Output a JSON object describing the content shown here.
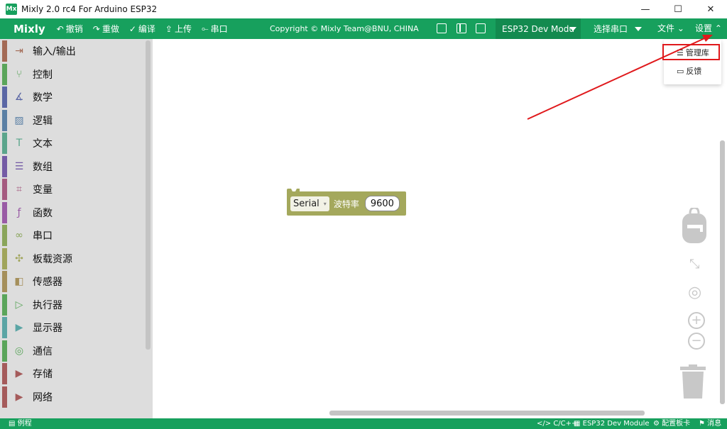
{
  "window": {
    "icon_text": "Mx",
    "title": "Mixly 2.0 rc4 For Arduino ESP32",
    "minimize_glyph": "—",
    "maximize_glyph": "☐",
    "close_glyph": "✕"
  },
  "toolbar": {
    "brand": "Mixly",
    "undo": "撤销",
    "redo": "重做",
    "compile": "编译",
    "upload": "上传",
    "serial": "串口",
    "copyright": "Copyright © Mixly Team@BNU, CHINA",
    "board": "ESP32 Dev Modu",
    "port": "选择串口",
    "file_menu": "文件",
    "settings_menu": "设置",
    "icons": {
      "undo": "↶",
      "redo": "↷",
      "compile": "✓",
      "upload": "⇪",
      "serial": "⟜",
      "file_caret": "⌄",
      "settings_caret": "⌃"
    }
  },
  "sidebar": {
    "categories": [
      {
        "label": "输入/输出",
        "icon": "⇥",
        "color": "#a36a55"
      },
      {
        "label": "控制",
        "icon": "⑂",
        "color": "#5ba55b"
      },
      {
        "label": "数学",
        "icon": "∡",
        "color": "#5b67a5"
      },
      {
        "label": "逻辑",
        "icon": "▨",
        "color": "#5b80a5"
      },
      {
        "label": "文本",
        "icon": "T",
        "color": "#5ba58c"
      },
      {
        "label": "数组",
        "icon": "☰",
        "color": "#745ba5"
      },
      {
        "label": "变量",
        "icon": "⌗",
        "color": "#a55b80"
      },
      {
        "label": "函数",
        "icon": "ƒ",
        "color": "#995ba5"
      },
      {
        "label": "串口",
        "icon": "∞",
        "color": "#8aa55b"
      },
      {
        "label": "板载资源",
        "icon": "✣",
        "color": "#a0a55b"
      },
      {
        "label": "传感器",
        "icon": "◧",
        "color": "#a58f5b"
      },
      {
        "label": "执行器",
        "icon": "▷",
        "color": "#5ba55b"
      },
      {
        "label": "显示器",
        "icon": "▶",
        "color": "#5ba5a5"
      },
      {
        "label": "通信",
        "icon": "◎",
        "color": "#5ba55b"
      },
      {
        "label": "存储",
        "icon": "▶",
        "color": "#a55b5b"
      },
      {
        "label": "网络",
        "icon": "▶",
        "color": "#a55b5b"
      }
    ]
  },
  "block": {
    "dropdown_value": "Serial",
    "dropdown_arrow": "▾",
    "label": "波特率",
    "value": "9600"
  },
  "settings_dropdown": {
    "items": [
      {
        "label": "管理库",
        "icon": "☰"
      },
      {
        "label": "反馈",
        "icon": "▭"
      }
    ]
  },
  "workspace_controls": {
    "fit_icon": "⤡",
    "center_icon": "◎",
    "zoom_in": "+",
    "zoom_out": "−"
  },
  "statusbar": {
    "examples": "例程",
    "language": "C/C++",
    "board": "ESP32 Dev Module",
    "config_board": "配置板卡",
    "messages": "消息",
    "icons": {
      "examples": "▤",
      "language": "</>",
      "board": "▦",
      "config": "⚙",
      "messages": "⚑"
    }
  },
  "colors": {
    "primary": "#17a05d",
    "board_select_bg": "#138a4f",
    "block": "#a4a85c",
    "highlight": "#e0191c"
  }
}
